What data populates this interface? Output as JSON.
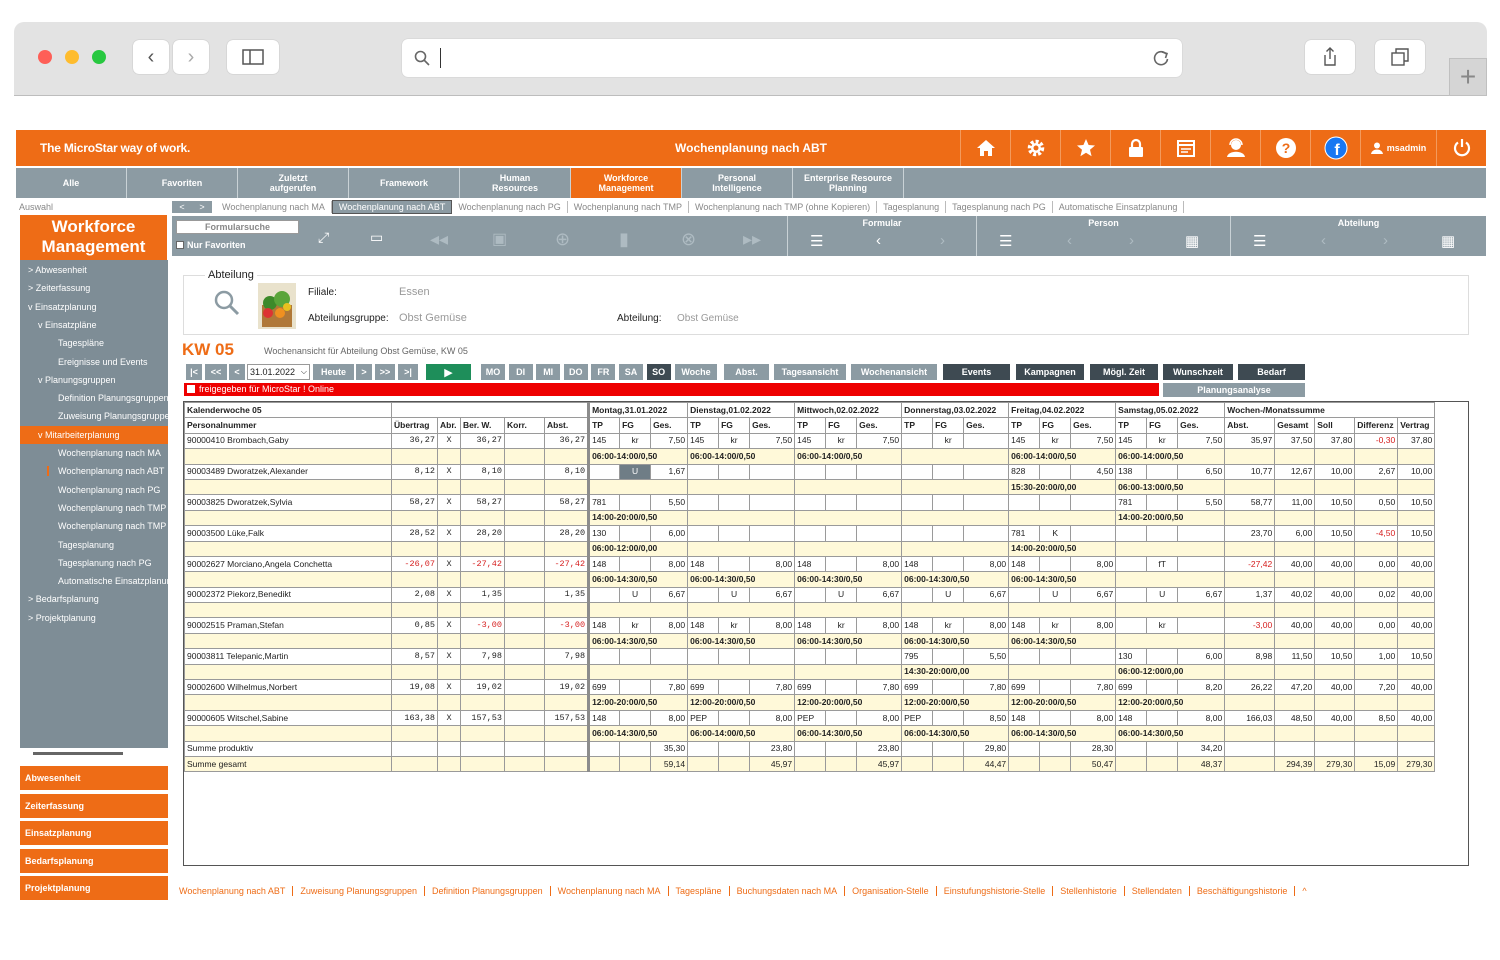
{
  "header": {
    "brand": "The MicroStar way of work.",
    "title": "Wochenplanung nach ABT",
    "user": "msadmin"
  },
  "nav": [
    "Alle",
    "Favoriten",
    "Zuletzt aufgerufen",
    "Framework",
    "Human Resources",
    "Workforce Management",
    "Personal Intelligence",
    "Enterprise Resource Planning"
  ],
  "auswahl": "Auswahl",
  "module_title": "Workforce Management",
  "tabs": [
    "Wochenplanung nach MA",
    "Wochenplanung nach ABT",
    "Wochenplanung nach PG",
    "Wochenplanung nach TMP",
    "Wochenplanung nach TMP (ohne Kopieren)",
    "Tagesplanung",
    "Tagesplanung nach PG",
    "Automatische Einsatzplanung"
  ],
  "toolbar": {
    "search": "Formularsuche",
    "nur_favoriten": "Nur Favoriten",
    "formular": "Formular",
    "person": "Person",
    "abteilung": "Abteilung"
  },
  "sidebar": [
    {
      "label": "> Abwesenheit",
      "indent": 8
    },
    {
      "label": "> Zeiterfassung",
      "indent": 8
    },
    {
      "label": "v Einsatzplanung",
      "indent": 8
    },
    {
      "label": "v Einsatzpläne",
      "indent": 18
    },
    {
      "label": "Tagespläne",
      "indent": 38
    },
    {
      "label": "Ereignisse und Events",
      "indent": 38
    },
    {
      "label": "v Planungsgruppen",
      "indent": 18
    },
    {
      "label": "Definition Planungsgruppen",
      "indent": 38
    },
    {
      "label": "Zuweisung Planungsgruppen",
      "indent": 38
    },
    {
      "label": "v Mitarbeiterplanung",
      "indent": 18
    },
    {
      "label": "Wochenplanung nach MA",
      "indent": 38
    },
    {
      "label": "Wochenplanung nach ABT",
      "indent": 38
    },
    {
      "label": "Wochenplanung nach PG",
      "indent": 38
    },
    {
      "label": "Wochenplanung nach TMP",
      "indent": 38
    },
    {
      "label": "Wochenplanung nach TMP",
      "indent": 38
    },
    {
      "label": "Tagesplanung",
      "indent": 38
    },
    {
      "label": "Tagesplanung nach PG",
      "indent": 38
    },
    {
      "label": "Automatische Einsatzplanung",
      "indent": 38
    },
    {
      "label": "> Bedarfsplanung",
      "indent": 8
    },
    {
      "label": "> Projektplanung",
      "indent": 8
    }
  ],
  "side_buttons": [
    "Abwesenheit",
    "Zeiterfassung",
    "Einsatzplanung",
    "Bedarfsplanung",
    "Projektplanung"
  ],
  "abteilung_panel": {
    "legend": "Abteilung",
    "filiale_label": "Filiale:",
    "filiale": "Essen",
    "gruppe_label": "Abteilungsgruppe:",
    "gruppe": "Obst  Gemüse",
    "abteilung_label": "Abteilung:",
    "abteilung": "Obst  Gemüse"
  },
  "kw": "KW 05",
  "kw_desc": "Wochenansicht für Abteilung Obst Gemüse, KW 05",
  "controls": {
    "first": "|<",
    "prev2": "<<",
    "prev": "<",
    "date": "31.01.2022",
    "today": "Heute",
    "next": ">",
    "next2": ">>",
    "last": ">|",
    "days": [
      "MO",
      "DI",
      "MI",
      "DO",
      "FR",
      "SA",
      "SO"
    ],
    "woche": "Woche",
    "abst": "Abst.",
    "tagesansicht": "Tagesansicht",
    "wochenansicht": "Wochenansicht",
    "events": "Events",
    "kampagnen": "Kampagnen",
    "moegl": "Mögl. Zeit",
    "wunschzeit": "Wunschzeit",
    "bedarf": "Bedarf",
    "planungsanalyse": "Planungsanalyse"
  },
  "release_note": "freigegeben für MicroStar ! Online",
  "grid": {
    "h1": [
      "Kalenderwoche 05",
      "Montag,31.01.2022",
      "Dienstag,01.02.2022",
      "Mittwoch,02.02.2022",
      "Donnerstag,03.02.2022",
      "Freitag,04.02.2022",
      "Samstag,05.02.2022",
      "Wochen-/Monatssumme"
    ],
    "h2": [
      "Personalnummer",
      "Übertrag",
      "Abr.",
      "Ber. W.",
      "Korr.",
      "Abst.",
      "TP",
      "FG",
      "Ges.",
      "TP",
      "FG",
      "Ges.",
      "TP",
      "FG",
      "Ges.",
      "TP",
      "FG",
      "Ges.",
      "TP",
      "FG",
      "Ges.",
      "TP",
      "FG",
      "Ges.",
      "Abst.",
      "Gesamt",
      "Soll",
      "Differenz",
      "Vertrag"
    ],
    "rows": [
      {
        "c": [
          "90000410  Brombach,Gaby",
          "36,27",
          "X",
          "36,27",
          "",
          "36,27",
          "145",
          "kr",
          "7,50",
          "145",
          "kr",
          "7,50",
          "145",
          "kr",
          "7,50",
          "",
          "kr",
          "",
          "145",
          "kr",
          "7,50",
          "145",
          "kr",
          "7,50",
          "35,97",
          "37,50",
          "37,80",
          "-0,30",
          "37,80"
        ],
        "s": [
          "06:00-14:00/0,50",
          "06:00-14:00/0,50",
          "06:00-14:00/0,50",
          "",
          "06:00-14:00/0,50",
          "06:00-14:00/0,50"
        ]
      },
      {
        "c": [
          "90003489  Dworatzek,Alexander",
          "8,12",
          "X",
          "8,10",
          "",
          "8,10",
          "",
          "U",
          "1,67",
          "",
          "",
          "",
          "",
          "",
          "",
          "",
          "",
          "",
          "828",
          "",
          "4,50",
          "138",
          "",
          "6,50",
          "10,77",
          "12,67",
          "10,00",
          "2,67",
          "10,00"
        ],
        "s": [
          "",
          "",
          "",
          "",
          "15:30-20:00/0,00",
          "06:00-13:00/0,50"
        ]
      },
      {
        "c": [
          "90003825  Dworatzek,Sylvia",
          "58,27",
          "X",
          "58,27",
          "",
          "58,27",
          "781",
          "",
          "5,50",
          "",
          "",
          "",
          "",
          "",
          "",
          "",
          "",
          "",
          "",
          "",
          "",
          "781",
          "",
          "5,50",
          "58,77",
          "11,00",
          "10,50",
          "0,50",
          "10,50"
        ],
        "s": [
          "14:00-20:00/0,50",
          "",
          "",
          "",
          "",
          "14:00-20:00/0,50"
        ]
      },
      {
        "c": [
          "90003500  Lüke,Falk",
          "28,52",
          "X",
          "28,20",
          "",
          "28,20",
          "130",
          "",
          "6,00",
          "",
          "",
          "",
          "",
          "",
          "",
          "",
          "",
          "",
          "781",
          "K",
          "",
          "",
          "",
          "",
          "23,70",
          "6,00",
          "10,50",
          "-4,50",
          "10,50"
        ],
        "s": [
          "06:00-12:00/0,00",
          "",
          "",
          "",
          "14:00-20:00/0,50",
          ""
        ]
      },
      {
        "c": [
          "90002627  Morciano,Angela Conchetta",
          "-26,07",
          "X",
          "-27,42",
          "",
          "-27,42",
          "148",
          "",
          "8,00",
          "148",
          "",
          "8,00",
          "148",
          "",
          "8,00",
          "148",
          "",
          "8,00",
          "148",
          "",
          "8,00",
          "",
          "fT",
          "",
          "-27,42",
          "40,00",
          "40,00",
          "0,00",
          "40,00"
        ],
        "s": [
          "06:00-14:30/0,50",
          "06:00-14:30/0,50",
          "06:00-14:30/0,50",
          "06:00-14:30/0,50",
          "06:00-14:30/0,50",
          ""
        ]
      },
      {
        "c": [
          "90002372  Piekorz,Benedikt",
          "2,08",
          "X",
          "1,35",
          "",
          "1,35",
          "",
          "U",
          "6,67",
          "",
          "U",
          "6,67",
          "",
          "U",
          "6,67",
          "",
          "U",
          "6,67",
          "",
          "U",
          "6,67",
          "",
          "U",
          "6,67",
          "1,37",
          "40,02",
          "40,00",
          "0,02",
          "40,00"
        ],
        "s": [
          "",
          "",
          "",
          "",
          "",
          ""
        ]
      },
      {
        "c": [
          "90002515  Praman,Stefan",
          "0,85",
          "X",
          "-3,00",
          "",
          "-3,00",
          "148",
          "kr",
          "8,00",
          "148",
          "kr",
          "8,00",
          "148",
          "kr",
          "8,00",
          "148",
          "kr",
          "8,00",
          "148",
          "kr",
          "8,00",
          "",
          "kr",
          "",
          "-3,00",
          "40,00",
          "40,00",
          "0,00",
          "40,00"
        ],
        "s": [
          "06:00-14:30/0,50",
          "06:00-14:30/0,50",
          "06:00-14:30/0,50",
          "06:00-14:30/0,50",
          "06:00-14:30/0,50",
          ""
        ]
      },
      {
        "c": [
          "90003811  Telepanic,Martin",
          "8,57",
          "X",
          "7,98",
          "",
          "7,98",
          "",
          "",
          "",
          "",
          "",
          "",
          "",
          "",
          "",
          "795",
          "",
          "5,50",
          "",
          "",
          "",
          "130",
          "",
          "6,00",
          "8,98",
          "11,50",
          "10,50",
          "1,00",
          "10,50"
        ],
        "s": [
          "",
          "",
          "",
          "14:30-20:00/0,00",
          "",
          "06:00-12:00/0,00"
        ]
      },
      {
        "c": [
          "90002600  Wilhelmus,Norbert",
          "19,08",
          "X",
          "19,02",
          "",
          "19,02",
          "699",
          "",
          "7,80",
          "699",
          "",
          "7,80",
          "699",
          "",
          "7,80",
          "699",
          "",
          "7,80",
          "699",
          "",
          "7,80",
          "699",
          "",
          "8,20",
          "26,22",
          "47,20",
          "40,00",
          "7,20",
          "40,00"
        ],
        "s": [
          "12:00-20:00/0,50",
          "12:00-20:00/0,50",
          "12:00-20:00/0,50",
          "12:00-20:00/0,50",
          "12:00-20:00/0,50",
          "12:00-20:00/0,50"
        ]
      },
      {
        "c": [
          "90000605  Witschel,Sabine",
          "163,38",
          "X",
          "157,53",
          "",
          "157,53",
          "148",
          "",
          "8,00",
          "PEP",
          "",
          "8,00",
          "PEP",
          "",
          "8,00",
          "PEP",
          "",
          "8,50",
          "148",
          "",
          "8,00",
          "148",
          "",
          "8,00",
          "166,03",
          "48,50",
          "40,00",
          "8,50",
          "40,00"
        ],
        "s": [
          "06:00-14:30/0,50",
          "06:00-14:00/0,50",
          "06:00-14:30/0,50",
          "06:00-14:30/0,50",
          "06:00-14:30/0,50",
          "06:00-14:30/0,50"
        ]
      }
    ],
    "sum_prod": {
      "label": "Summe produktiv",
      "days": [
        "35,30",
        "23,80",
        "23,80",
        "29,80",
        "28,30",
        "34,20"
      ]
    },
    "sum_ges": {
      "label": "Summe gesamt",
      "days": [
        "59,14",
        "45,97",
        "45,97",
        "44,47",
        "50,47",
        "48,37"
      ],
      "totals": [
        "294,39",
        "279,30",
        "15,09",
        "279,30"
      ]
    }
  },
  "footer": [
    "Wochenplanung nach ABT",
    "Zuweisung Planungsgruppen",
    "Definition Planungsgruppen",
    "Wochenplanung nach MA",
    "Tagespläne",
    "Buchungsdaten nach MA",
    "Organisation-Stelle",
    "Einstufungshistorie-Stelle",
    "Stellenhistorie",
    "Stellendaten",
    "Beschäftigungshistorie",
    "^"
  ],
  "colors": {
    "brand": "#ee6c16",
    "nav": "#8c9ba3",
    "sidebar": "#7e8d96",
    "shift_bg": "#fff9d9",
    "negative": "#d62020"
  }
}
